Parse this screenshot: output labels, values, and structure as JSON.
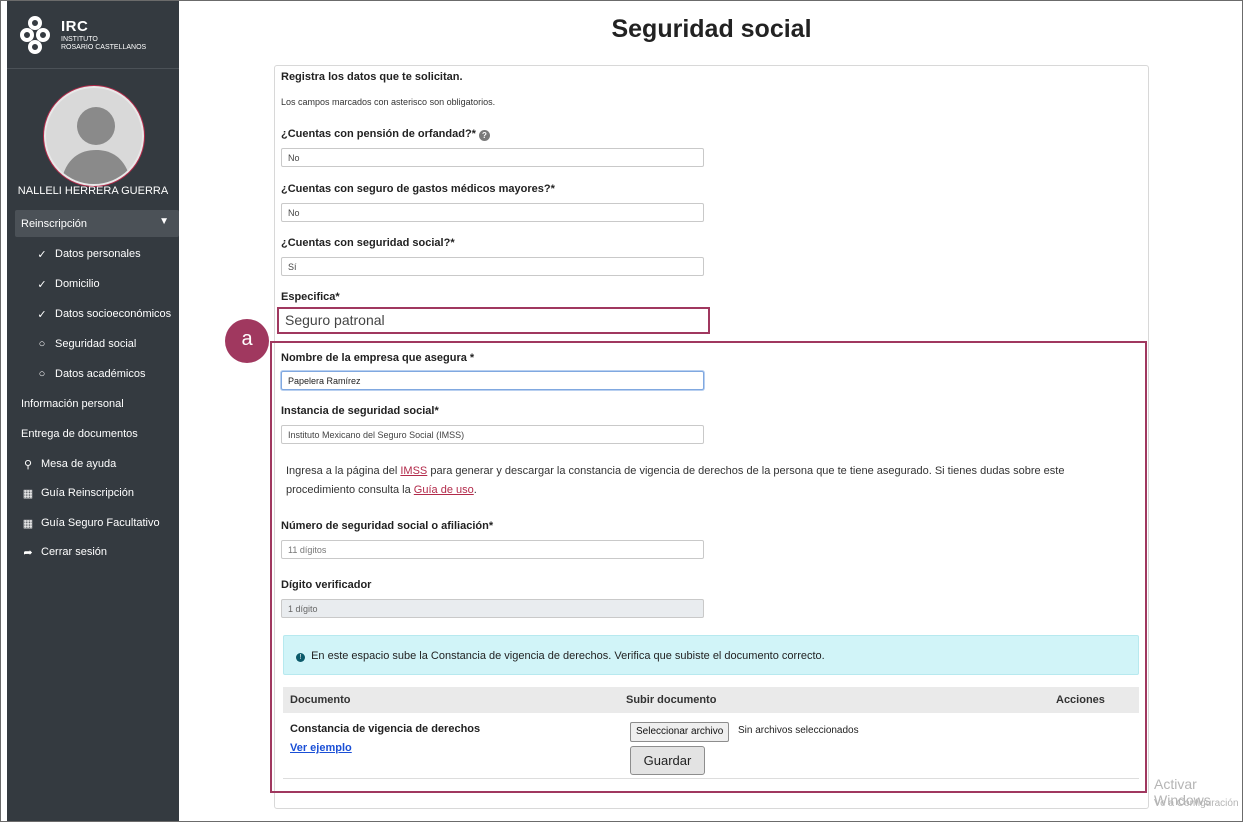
{
  "brand": {
    "name": "IRC",
    "line1": "INSTITUTO",
    "line2": "ROSARIO CASTELLANOS"
  },
  "user": {
    "name": "NALLELI HERRERA GUERRA"
  },
  "sidebar": {
    "reinscripcion_label": "Reinscripción",
    "items": [
      {
        "label": "Datos personales"
      },
      {
        "label": "Domicilio"
      },
      {
        "label": "Datos socioeconómicos"
      },
      {
        "label": "Seguridad social"
      },
      {
        "label": "Datos académicos"
      },
      {
        "label": "Información personal"
      },
      {
        "label": "Entrega de documentos"
      },
      {
        "label": "Mesa de ayuda"
      },
      {
        "label": "Guía Reinscripción"
      },
      {
        "label": "Guía Seguro Facultativo"
      },
      {
        "label": "Cerrar sesión"
      }
    ]
  },
  "page": {
    "title": "Seguridad social",
    "intro": "Registra los datos que te solicitan.",
    "note": "Los campos marcados con asterisco son obligatorios."
  },
  "form": {
    "orfandad": {
      "label": "¿Cuentas con pensión de orfandad?*",
      "value": "No"
    },
    "gastos": {
      "label": "¿Cuentas con seguro de gastos médicos mayores?*",
      "value": "No"
    },
    "seguridad": {
      "label": "¿Cuentas con seguridad social?*",
      "value": "Sí"
    },
    "especifica": {
      "label": "Especifica*",
      "value": "Seguro patronal"
    },
    "empresa": {
      "label": "Nombre de la empresa que asegura *",
      "value": "Papelera Ramírez"
    },
    "instancia": {
      "label": "Instancia de seguridad social*",
      "value": "Instituto Mexicano del Seguro Social (IMSS)"
    },
    "info_pre": "Ingresa a la página del ",
    "info_link1": "IMSS",
    "info_mid": " para generar y descargar la constancia de vigencia de derechos de la persona que te tiene asegurado. Si tienes dudas sobre este procedimiento consulta la ",
    "info_link2": "Guía de uso",
    "info_post": ".",
    "nss": {
      "label": "Número de seguridad social o afiliación*",
      "placeholder": "11 dígitos"
    },
    "digito": {
      "label": "Dígito verificador",
      "placeholder": "1 dígito"
    }
  },
  "annotation": {
    "badge": "a"
  },
  "alert": {
    "text": "En este espacio sube la Constancia de vigencia de derechos. Verifica que subiste el documento correcto.",
    "icon": "!"
  },
  "table": {
    "headers": {
      "documento": "Documento",
      "subir": "Subir documento",
      "acciones": "Acciones"
    },
    "row": {
      "title": "Constancia de vigencia de derechos",
      "link": "Ver ejemplo",
      "file_button": "Seleccionar archivo",
      "file_status": "Sin archivos seleccionados",
      "save": "Guardar"
    }
  },
  "watermark": {
    "line1": "Activar Windows",
    "line2": "Ve a Configuración"
  },
  "colors": {
    "accent": "#a0385f",
    "sidebar": "#343a40",
    "alert_bg": "#d1f4f8"
  }
}
